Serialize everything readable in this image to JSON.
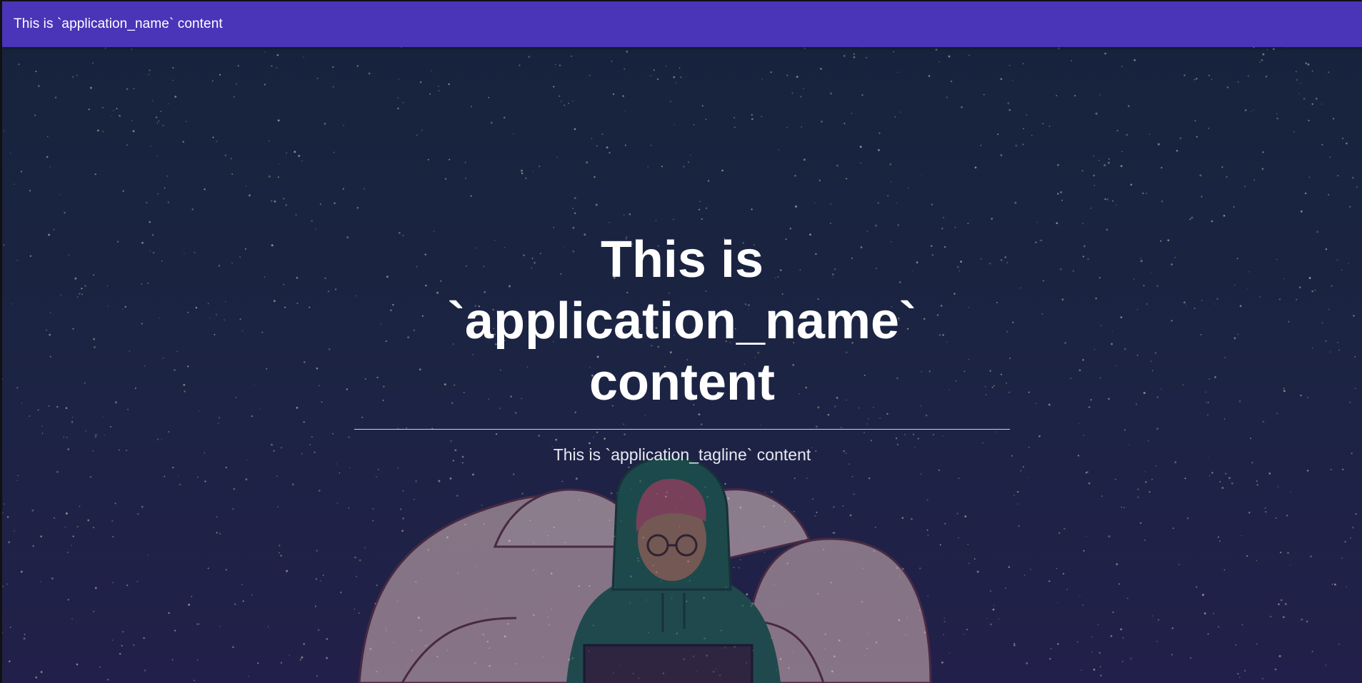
{
  "topbar": {
    "title": "This is `application_name` content",
    "color": "#4a35b8"
  },
  "hero": {
    "title": "This is `application_name` content",
    "tagline": "This is `application_tagline` content",
    "background_colors": [
      "#17233d",
      "#22204a"
    ]
  },
  "illustration": {
    "description_icon": "person-on-beanbag-with-laptop"
  }
}
